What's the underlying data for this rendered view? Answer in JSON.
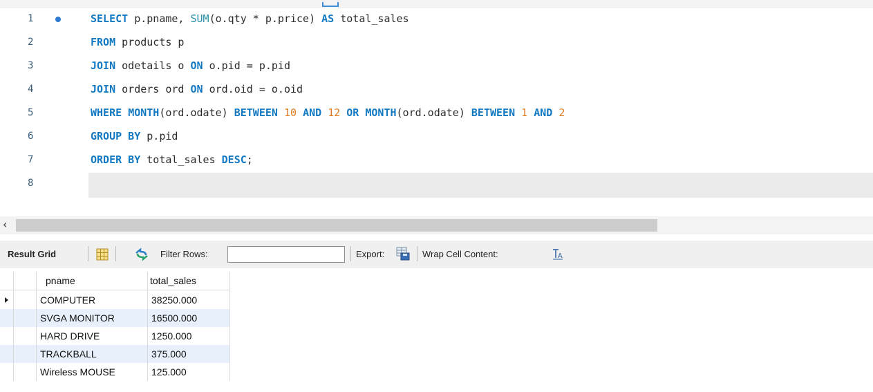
{
  "editor": {
    "lines": [
      {
        "num": "1",
        "tokens": [
          {
            "t": "SELECT",
            "c": "kw"
          },
          {
            "t": " p.pname, "
          },
          {
            "t": "SUM",
            "c": "fn"
          },
          {
            "t": "(o.qty * p.price) "
          },
          {
            "t": "AS",
            "c": "kw"
          },
          {
            "t": " total_sales"
          }
        ]
      },
      {
        "num": "2",
        "tokens": [
          {
            "t": "FROM",
            "c": "kw"
          },
          {
            "t": " products p"
          }
        ]
      },
      {
        "num": "3",
        "tokens": [
          {
            "t": "JOIN",
            "c": "kw"
          },
          {
            "t": " odetails o "
          },
          {
            "t": "ON",
            "c": "kw"
          },
          {
            "t": " o.pid = p.pid"
          }
        ]
      },
      {
        "num": "4",
        "tokens": [
          {
            "t": "JOIN",
            "c": "kw"
          },
          {
            "t": " orders ord "
          },
          {
            "t": "ON",
            "c": "kw"
          },
          {
            "t": " ord.oid = o.oid"
          }
        ]
      },
      {
        "num": "5",
        "tokens": [
          {
            "t": "WHERE",
            "c": "kw"
          },
          {
            "t": " "
          },
          {
            "t": "MONTH",
            "c": "kw"
          },
          {
            "t": "(ord.odate) "
          },
          {
            "t": "BETWEEN",
            "c": "kw"
          },
          {
            "t": " "
          },
          {
            "t": "10",
            "c": "num"
          },
          {
            "t": " "
          },
          {
            "t": "AND",
            "c": "kw"
          },
          {
            "t": " "
          },
          {
            "t": "12",
            "c": "num"
          },
          {
            "t": " "
          },
          {
            "t": "OR",
            "c": "kw"
          },
          {
            "t": " "
          },
          {
            "t": "MONTH",
            "c": "kw"
          },
          {
            "t": "(ord.odate) "
          },
          {
            "t": "BETWEEN",
            "c": "kw"
          },
          {
            "t": " "
          },
          {
            "t": "1",
            "c": "num"
          },
          {
            "t": " "
          },
          {
            "t": "AND",
            "c": "kw"
          },
          {
            "t": " "
          },
          {
            "t": "2",
            "c": "num"
          }
        ]
      },
      {
        "num": "6",
        "tokens": [
          {
            "t": "GROUP BY",
            "c": "kw"
          },
          {
            "t": " p.pid"
          }
        ]
      },
      {
        "num": "7",
        "tokens": [
          {
            "t": "ORDER BY",
            "c": "kw"
          },
          {
            "t": " total_sales "
          },
          {
            "t": "DESC",
            "c": "kw"
          },
          {
            "t": ";"
          }
        ]
      },
      {
        "num": "8",
        "tokens": []
      }
    ]
  },
  "toolbar": {
    "result_grid_label": "Result Grid",
    "filter_label": "Filter Rows:",
    "filter_value": "",
    "export_label": "Export:",
    "wrap_label": "Wrap Cell Content:"
  },
  "grid": {
    "columns": [
      "pname",
      "total_sales"
    ],
    "rows": [
      [
        "COMPUTER",
        "38250.000"
      ],
      [
        "SVGA MONITOR",
        "16500.000"
      ],
      [
        "HARD DRIVE",
        "1250.000"
      ],
      [
        "TRACKBALL",
        "375.000"
      ],
      [
        "Wireless MOUSE",
        "125.000"
      ]
    ]
  },
  "colors": {
    "keyword": "#1279c2",
    "function": "#2a8fa8",
    "number": "#e07a1f",
    "alt_row": "#e8f0fb"
  }
}
